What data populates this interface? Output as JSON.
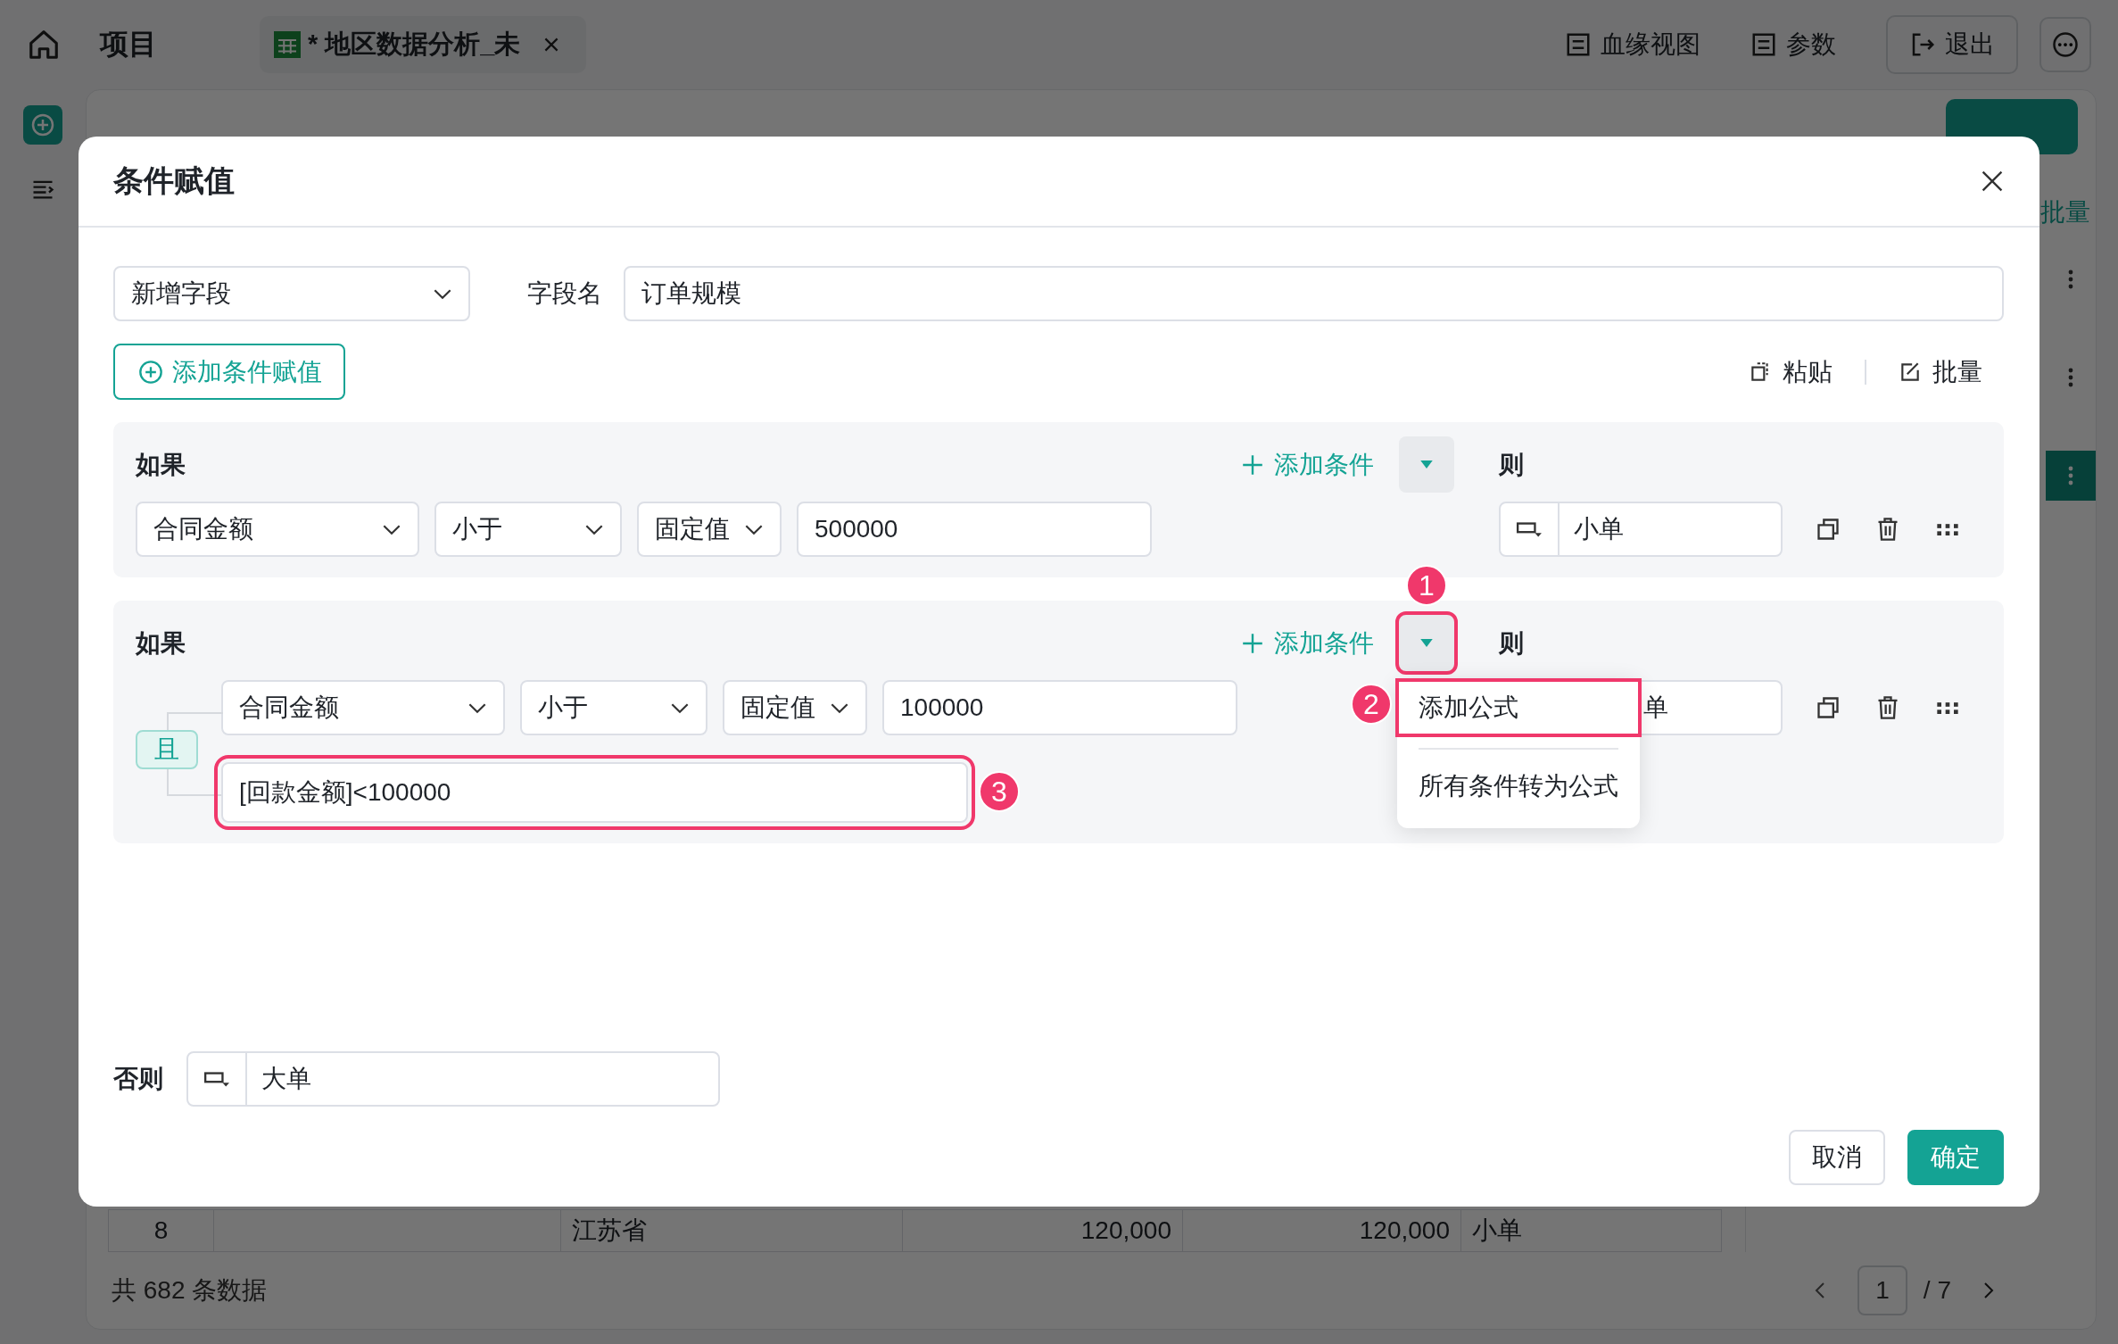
{
  "top_bar": {
    "title": "项目",
    "tab": {
      "label": "* 地区数据分析_未"
    },
    "actions": [
      "血缘视图",
      "参数"
    ],
    "exit": "退出"
  },
  "side_panel": {
    "title": "批量",
    "rows": [
      {
        "selected": false
      },
      {
        "selected": false
      },
      {
        "selected": true
      }
    ]
  },
  "table": {
    "rows": [
      {
        "cells": [
          "8",
          "",
          "江苏省",
          "120,000",
          "120,000",
          "小单"
        ]
      }
    ]
  },
  "footer": {
    "total": "共 682 条数据",
    "page": "1",
    "pages": "/ 7"
  },
  "dialog": {
    "title": "条件赋值",
    "field_mode": "新增字段",
    "field_name_label": "字段名",
    "field_name": "订单规模",
    "add_button": "添加条件赋值",
    "paste": "粘贴",
    "batch": "批量",
    "blocks": [
      {
        "if_label": "如果",
        "add_condition": "添加条件",
        "then_label": "则",
        "menu_button": {
          "highlighted": false
        },
        "conditions": [
          {
            "field": "合同金额",
            "operator": "小于",
            "value_type": "固定值",
            "value": "500000"
          }
        ],
        "then_value": "小单",
        "then_partly_covered": false
      },
      {
        "if_label": "如果",
        "add_condition": "添加条件",
        "then_label": "则",
        "menu_button": {
          "highlighted": true,
          "badge": "1"
        },
        "joiner": "且",
        "conditions": [
          {
            "field": "合同金额",
            "operator": "小于",
            "value_type": "固定值",
            "value": "100000"
          }
        ],
        "formulas": [
          {
            "text": "[回款金额]<100000",
            "highlighted": true,
            "badge": "3"
          }
        ],
        "then_value": "单",
        "then_partly_covered": true,
        "menu": {
          "items": [
            {
              "label": "添加公式",
              "highlighted": true,
              "badge": "2"
            },
            {
              "label": "所有条件转为公式",
              "highlighted": false
            }
          ]
        }
      }
    ],
    "else_label": "否则",
    "else_value": "大单",
    "cancel": "取消",
    "ok": "确定"
  }
}
